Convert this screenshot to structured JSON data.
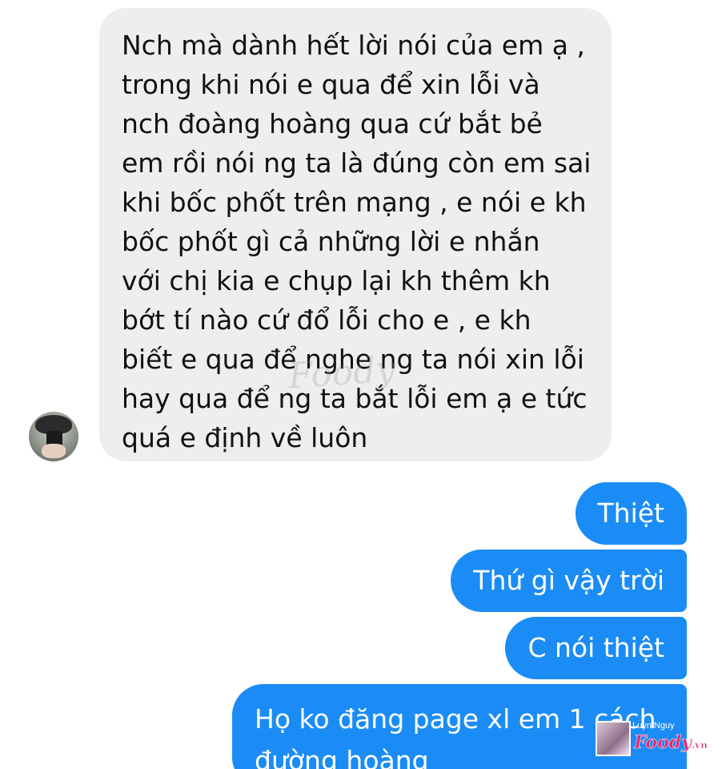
{
  "conversation": {
    "incoming_message": "Nch mà dành hết lời nói của em ạ ,\ntrong khi nói e qua để xin lỗi và\nnch đoàng hoàng qua cứ bắt bẻ\nem rồi nói ng ta là đúng còn em sai\nkhi bốc phốt trên mạng , e nói e kh\nbốc phốt gì cả những lời e nhắn\nvới chị kia e chụp lại kh thêm kh\nbớt tí nào cứ đổ lỗi cho e , e kh\nbiết e qua để nghe ng ta nói xin lỗi\nhay qua để ng ta bắt lỗi em ạ e tức\nquá e định về luôn",
    "outgoing_messages": [
      "Thiệt",
      "Thứ gì vậy trời",
      "C nói thiệt",
      "Họ ko đăng page xl em 1 cách\nđường hoàng"
    ]
  },
  "watermark": {
    "center_text": "Foody",
    "corner_name": "Luyn Nguy",
    "corner_logo": "Foody",
    "corner_suffix": ".vn"
  },
  "colors": {
    "incoming_bubble": "#eeeef0",
    "outgoing_bubble": "#1b8cf6",
    "logo_pink": "#e8236f"
  }
}
